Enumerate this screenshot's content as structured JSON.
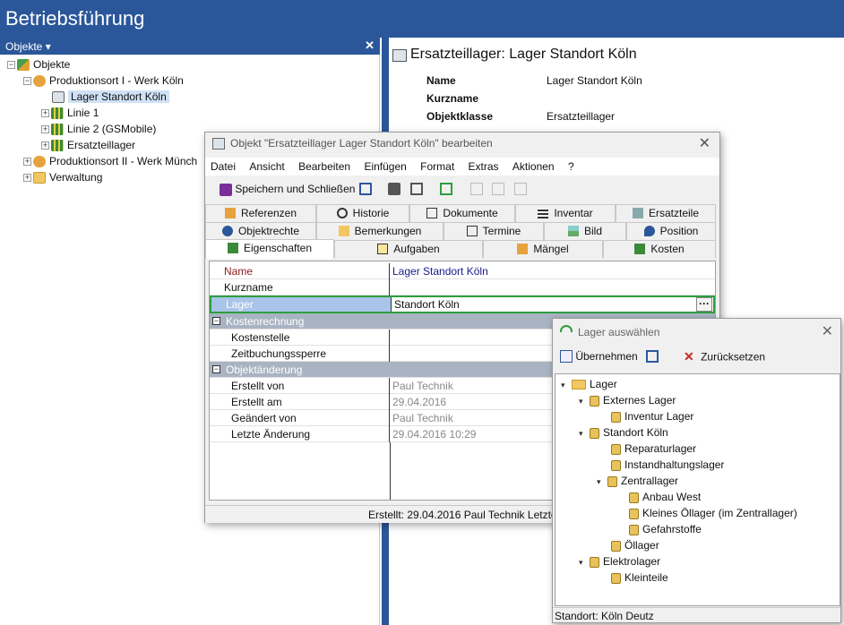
{
  "app": {
    "title": "Betriebsführung"
  },
  "left_pane": {
    "header": "Objekte ▾",
    "close": "✕",
    "tree": [
      {
        "label": "Objekte",
        "level": 0,
        "expander": "−"
      },
      {
        "label": "Produktionsort I - Werk Köln",
        "level": 1,
        "expander": "−"
      },
      {
        "label": "Lager Standort Köln",
        "level": 2,
        "expander": "",
        "selected": true
      },
      {
        "label": "Linie 1",
        "level": 2,
        "expander": "+"
      },
      {
        "label": "Linie 2 (GSMobile)",
        "level": 2,
        "expander": "+"
      },
      {
        "label": "Ersatzteillager",
        "level": 2,
        "expander": "+"
      },
      {
        "label": "Produktionsort II - Werk Münch",
        "level": 1,
        "expander": "+"
      },
      {
        "label": "Verwaltung",
        "level": 1,
        "expander": "+"
      }
    ]
  },
  "right_pane": {
    "title": "Ersatzteillager: Lager Standort Köln",
    "fields": [
      {
        "label": "Name",
        "value": "Lager Standort Köln"
      },
      {
        "label": "Kurzname",
        "value": ""
      },
      {
        "label": "Objektklasse",
        "value": "Ersatzteillager"
      }
    ]
  },
  "dialog": {
    "title": "Objekt \"Ersatzteillager Lager Standort Köln\" bearbeiten",
    "close": "✕",
    "menu": [
      "Datei",
      "Ansicht",
      "Bearbeiten",
      "Einfügen",
      "Format",
      "Extras",
      "Aktionen",
      "?"
    ],
    "save_label": "Speichern und Schließen",
    "tabs_row1": [
      "Referenzen",
      "Historie",
      "Dokumente",
      "Inventar",
      "Ersatzteile"
    ],
    "tabs_row2": [
      "Objektrechte",
      "Bemerkungen",
      "Termine",
      "Bild",
      "Position"
    ],
    "tabs_row3": [
      "Eigenschaften",
      "Aufgaben",
      "Mängel",
      "Kosten"
    ],
    "props": {
      "name_label": "Name",
      "name_value": "Lager Standort Köln",
      "kurzname_label": "Kurzname",
      "lager_label": "Lager",
      "lager_value": "Standort Köln",
      "lager_btn": "···",
      "cat1": "Kostenrechnung",
      "kostenstelle": "Kostenstelle",
      "zeitbuchung": "Zeitbuchungssperre",
      "cat2": "Objektänderung",
      "erstellt_von": "Erstellt von",
      "erstellt_von_val": "Paul Technik",
      "erstellt_am": "Erstellt am",
      "erstellt_am_val": "29.04.2016",
      "geaendert_von": "Geändert von",
      "geaendert_von_val": "Paul Technik",
      "letzte_aenderung": "Letzte Änderung",
      "letzte_aenderung_val": "29.04.2016 10:29"
    },
    "status": "Erstellt: 29.04.2016 Paul Technik  Letzte"
  },
  "popup": {
    "title": "Lager auswählen",
    "close": "✕",
    "uebernehmen": "Übernehmen",
    "zuruecksetzen": "Zurücksetzen",
    "tree": [
      {
        "label": "Lager",
        "level": 0,
        "arrow": "▾",
        "folder": true
      },
      {
        "label": "Externes Lager",
        "level": 1,
        "arrow": "▾"
      },
      {
        "label": "Inventur Lager",
        "level": 2,
        "arrow": ""
      },
      {
        "label": "Standort Köln",
        "level": 1,
        "arrow": "▾"
      },
      {
        "label": "Reparaturlager",
        "level": 2,
        "arrow": ""
      },
      {
        "label": "Instandhaltungslager",
        "level": 2,
        "arrow": ""
      },
      {
        "label": "Zentrallager",
        "level": 2,
        "arrow": "▾"
      },
      {
        "label": "Anbau West",
        "level": 3,
        "arrow": ""
      },
      {
        "label": "Kleines Öllager (im Zentrallager)",
        "level": 3,
        "arrow": ""
      },
      {
        "label": "Gefahrstoffe",
        "level": 3,
        "arrow": ""
      },
      {
        "label": "Öllager",
        "level": 2,
        "arrow": ""
      },
      {
        "label": "Elektrolager",
        "level": 1,
        "arrow": "▾"
      },
      {
        "label": "Kleinteile",
        "level": 2,
        "arrow": ""
      }
    ],
    "status": "Standort: Köln Deutz"
  },
  "colors": {
    "title_bar": "#2b579a",
    "highlight_border": "#2e9e3e",
    "category": "#a9b4c2"
  }
}
